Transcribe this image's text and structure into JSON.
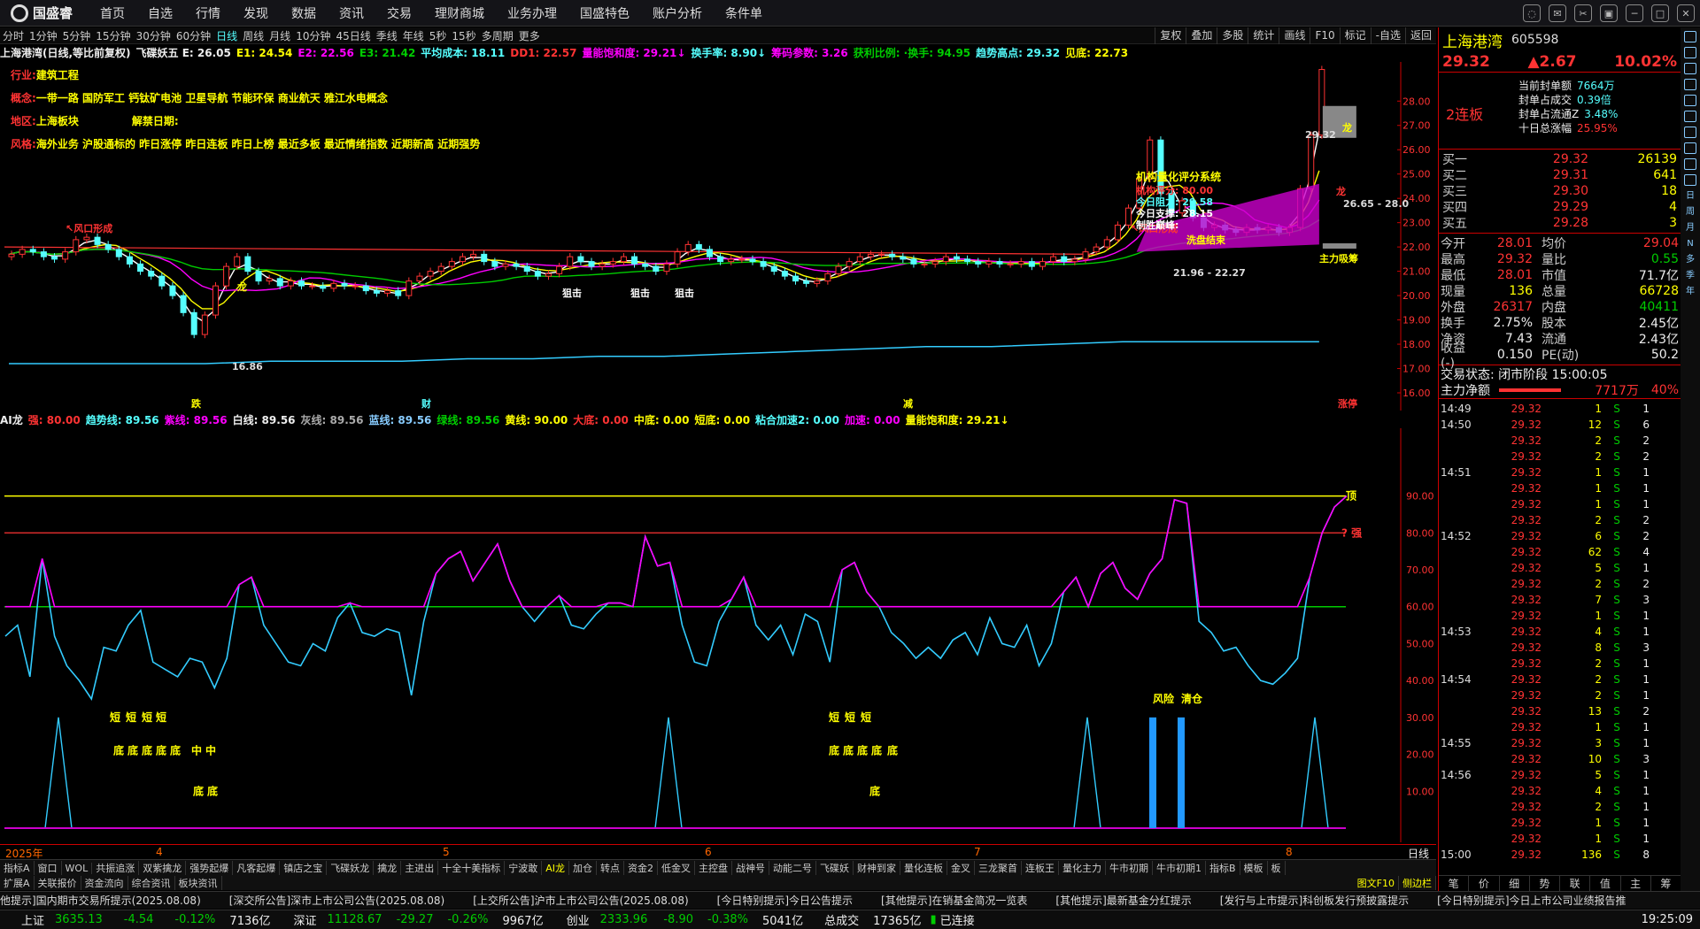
{
  "menu": {
    "logo": "国盛睿",
    "items": [
      "首页",
      "自选",
      "行情",
      "发现",
      "数据",
      "资讯",
      "交易",
      "理财商城",
      "业务办理",
      "国盛特色",
      "账户分析",
      "条件单"
    ]
  },
  "periods": [
    "分时",
    "1分钟",
    "5分钟",
    "15分钟",
    "30分钟",
    "60分钟",
    "日线",
    "周线",
    "月线",
    "10分钟",
    "45日线",
    "季线",
    "年线",
    "5秒",
    "15秒",
    "多周期",
    "更多"
  ],
  "active_period": "日线",
  "tools": [
    "复权",
    "叠加",
    "多股",
    "统计",
    "画线",
    "F10",
    "标记",
    "-自选",
    "返回"
  ],
  "ind1": [
    {
      "t": "上海港湾(日线,等比前复权)",
      "c": "white"
    },
    {
      "t": "飞碟妖五 E: 26.05",
      "c": "white"
    },
    {
      "t": "E1: 24.54",
      "c": "yellow"
    },
    {
      "t": "E2: 22.56",
      "c": "magenta"
    },
    {
      "t": "E3: 21.42",
      "c": "green"
    },
    {
      "t": "平均成本: 18.11",
      "c": "cyan"
    },
    {
      "t": "DD1: 22.57",
      "c": "red"
    },
    {
      "t": "量能饱和度: 29.21↓",
      "c": "magenta"
    },
    {
      "t": "换手率: 8.90↓",
      "c": "cyan"
    },
    {
      "t": "筹码参数: 3.26",
      "c": "magenta"
    },
    {
      "t": "获利比例: ·换手: 94.95",
      "c": "green"
    },
    {
      "t": "趋势高点: 29.32",
      "c": "cyan"
    },
    {
      "t": "见底: 22.73",
      "c": "yellow"
    }
  ],
  "info": {
    "industry_l": "行业:",
    "industry": "建筑工程",
    "concept_l": "概念:",
    "concept": "一带一路 国防军工 钙钛矿电池 卫星导航 节能环保 商业航天 雅江水电概念",
    "region_l": "地区:",
    "region": "上海板块",
    "unlock_l": "解禁日期:",
    "style_l": "风格:",
    "style": "海外业务 沪股通标的 昨日涨停 昨日连板 昨日上榜 最近多板 最近情绪指数 近期新高 近期强势"
  },
  "annotations": {
    "fengkou": "↖风口形成",
    "jgpf": "机构量化评分系统",
    "jgpf_score": "机构评分: 80.00",
    "zl": "今日阻力: 29.58",
    "zc": "今日支撑: 28.15",
    "zskx": "制胜巅峰:",
    "hpl": "洗盘结束",
    "zlxc": "主力吸筹",
    "zlxf": "主力吸筹",
    "lows": "16.86",
    "range": "21.96 - 22.27",
    "hi": "29.32",
    "hi2": "26.65 - 28.0",
    "jiji": "狙击",
    "long": "龙",
    "disp_bottom": "跌",
    "disp_cai": "财",
    "disp_jian": "减",
    "zhang": "涨停"
  },
  "chart_data": [
    {
      "type": "candlestick",
      "title": "上海港湾(日线,等比前复权)",
      "ylim": [
        16,
        29.32
      ],
      "yticks": [
        16,
        17,
        18,
        19,
        20,
        21,
        22,
        23,
        24,
        25,
        26,
        27,
        28
      ],
      "close": [
        21.7,
        21.9,
        21.8,
        21.6,
        21.5,
        21.8,
        22.3,
        22.4,
        22.1,
        21.9,
        21.6,
        21.3,
        21.0,
        20.8,
        20.4,
        20.0,
        19.3,
        18.4,
        19.2,
        20.4,
        21.2,
        21.6,
        21.0,
        20.6,
        20.7,
        20.4,
        20.6,
        20.4,
        20.4,
        20.3,
        20.5,
        20.4,
        20.4,
        20.2,
        20.1,
        20.2,
        20.0,
        20.6,
        20.8,
        21.0,
        21.2,
        21.4,
        21.6,
        21.7,
        21.4,
        21.2,
        21.3,
        21.2,
        21.0,
        20.8,
        20.9,
        21.2,
        21.6,
        21.4,
        21.2,
        21.3,
        21.4,
        21.6,
        21.3,
        21.2,
        21.0,
        21.3,
        21.8,
        22.1,
        21.9,
        21.6,
        21.4,
        21.5,
        21.5,
        21.4,
        21.2,
        21.0,
        20.8,
        20.6,
        20.5,
        20.6,
        20.9,
        21.2,
        21.4,
        21.6,
        21.7,
        21.7,
        21.6,
        21.5,
        21.3,
        21.3,
        21.4,
        21.6,
        21.5,
        21.4,
        21.3,
        21.4,
        21.3,
        21.3,
        21.4,
        21.2,
        21.4,
        21.6,
        21.4,
        21.5,
        21.8,
        22.0,
        22.3,
        22.9,
        23.6,
        24.8,
        26.4,
        24.2,
        23.4,
        23.9,
        23.2,
        22.8,
        22.9,
        22.7,
        22.6,
        22.8,
        22.7,
        22.8,
        22.6,
        22.8,
        24.4,
        26.6,
        29.3
      ],
      "avgcost": [
        17.2,
        17.2,
        17.2,
        17.2,
        17.3,
        17.3,
        17.3,
        17.4,
        17.4,
        17.5,
        17.5,
        17.6,
        17.7,
        17.8,
        17.9,
        17.9,
        18.0,
        18.1,
        18.1,
        18.1,
        18.1
      ],
      "cost_label": "平均成本"
    },
    {
      "type": "line",
      "title": "AI龙",
      "ylim": [
        0,
        100
      ],
      "yticks": [
        10,
        20,
        30,
        40,
        50,
        60,
        70,
        80,
        90
      ],
      "series": [
        {
          "name": "顶",
          "values": [
            90
          ]
        },
        {
          "name": "强",
          "values": [
            80
          ]
        },
        {
          "name": "绿线",
          "values": [
            60
          ]
        },
        {
          "name": "趋势线",
          "values": [
            52,
            55,
            41,
            73,
            52,
            44,
            40,
            35,
            49,
            48,
            55,
            59,
            45,
            43,
            41,
            46,
            45,
            38,
            46,
            66,
            68,
            55,
            50,
            45,
            44,
            50,
            48,
            57,
            61,
            53,
            52,
            54,
            53,
            36,
            56,
            69,
            73,
            75,
            67,
            72,
            77,
            67,
            60,
            56,
            60,
            63,
            55,
            54,
            58,
            61,
            61,
            60,
            79,
            71,
            72,
            55,
            45,
            44,
            56,
            62,
            68,
            55,
            51,
            55,
            47,
            58,
            56,
            45,
            70,
            72,
            64,
            60,
            53,
            50,
            46,
            49,
            46,
            51,
            53,
            47,
            57,
            50,
            49,
            55,
            44,
            50,
            64,
            68,
            60,
            69,
            72,
            65,
            62,
            69,
            73,
            89,
            88,
            56,
            53,
            48,
            49,
            44,
            40,
            39,
            42,
            46,
            68,
            80,
            87,
            90
          ]
        },
        {
          "name": "底",
          "values": [
            30,
            26,
            24,
            29,
            30,
            22,
            27,
            28
          ]
        }
      ],
      "labels": {
        "ding": "顶",
        "qiang": "? 强",
        "fengxian": "风险",
        "qingcang": "清仓",
        "di": "底",
        "duan": "短",
        "zhong": "中"
      }
    }
  ],
  "ind2": [
    {
      "t": "AI龙",
      "c": "white"
    },
    {
      "t": "强: 80.00",
      "c": "red"
    },
    {
      "t": "趋势线: 89.56",
      "c": "cyan"
    },
    {
      "t": "紫线: 89.56",
      "c": "magenta"
    },
    {
      "t": "白线: 89.56",
      "c": "white"
    },
    {
      "t": "灰线: 89.56",
      "c": "gray"
    },
    {
      "t": "蓝线: 89.56",
      "c": "blue"
    },
    {
      "t": "绿线: 89.56",
      "c": "green"
    },
    {
      "t": "黄线: 90.00",
      "c": "yellow"
    },
    {
      "t": "大底: 0.00",
      "c": "red"
    },
    {
      "t": "中底: 0.00",
      "c": "yellow"
    },
    {
      "t": "短底: 0.00",
      "c": "yellow"
    },
    {
      "t": "粘合加速2: 0.00",
      "c": "cyan"
    },
    {
      "t": "加速: 0.00",
      "c": "magenta"
    },
    {
      "t": "量能饱和度: 29.21↓",
      "c": "yellow"
    }
  ],
  "dates": [
    "2025年",
    "4",
    "5",
    "6",
    "7",
    "8"
  ],
  "daily_label": "日线",
  "bottom_tabs": [
    "指标A",
    "窗口",
    "WOL",
    "共振追涨",
    "双紫擒龙",
    "强势起爆",
    "凡客起爆",
    "镇店之宝",
    "飞碟妖龙",
    "擒龙",
    "主进出",
    "十全十美指标",
    "宁波敢",
    "AI龙",
    "加仓",
    "转点",
    "资金2",
    "低金叉",
    "主控盘",
    "战神号",
    "动能二号",
    "飞碟妖",
    "财神到家",
    "量化连板",
    "金叉",
    "三龙聚首",
    "连板王",
    "量化主力",
    "牛市初期",
    "牛市初期1",
    "指标B",
    "模板",
    "板"
  ],
  "bottom_tabs2": [
    "扩展A",
    "关联报价",
    "资金流向",
    "综合资讯",
    "板块资讯"
  ],
  "right_tab_bar": [
    "图文F10",
    "侧边栏"
  ],
  "news": [
    "他提示]国内期市交易所提示(2025.08.08)",
    "[深交所公告]深市上市公司公告(2025.08.08)",
    "[上交所公告]沪市上市公司公告(2025.08.08)",
    "[今日特别提示]今日公告提示",
    "[其他提示]在销基金简况一览表",
    "[其他提示]最新基金分红提示",
    "[发行与上市提示]科创板发行预披露提示",
    "[今日特别提示]今日上市公司业绩报告推"
  ],
  "status": {
    "sh_l": "上证",
    "sh": "3635.13",
    "sh_c": "-4.54",
    "sh_p": "-0.12%",
    "sh_v": "7136亿",
    "sz_l": "深证",
    "sz": "11128.67",
    "sz_c": "-29.27",
    "sz_p": "-0.26%",
    "sz_v": "9967亿",
    "cy_l": "创业",
    "cy": "2333.96",
    "cy_c": "-8.90",
    "cy_p": "-0.38%",
    "cy_v": "5041亿",
    "total_l": "总成交",
    "total": "17365亿",
    "conn": "已连接",
    "time": "19:25:09"
  },
  "quote": {
    "name": "上海港湾",
    "code": "605598",
    "price": "29.32",
    "change": "▲2.67",
    "pct": "10.02%",
    "lianban": "2连板",
    "limit": [
      [
        "当前封单额",
        "7664万"
      ],
      [
        "封单占成交",
        "0.39倍"
      ],
      [
        "封单占流通Z",
        "3.48%"
      ],
      [
        "十日总涨幅",
        "25.95%"
      ]
    ],
    "bids": [
      [
        "买一",
        "29.32",
        "26139"
      ],
      [
        "买二",
        "29.31",
        "641"
      ],
      [
        "买三",
        "29.30",
        "18"
      ],
      [
        "买四",
        "29.29",
        "4"
      ],
      [
        "买五",
        "29.28",
        "3"
      ]
    ],
    "stats": [
      [
        "今开",
        "28.01",
        "均价",
        "29.04"
      ],
      [
        "最高",
        "29.32",
        "量比",
        "0.55"
      ],
      [
        "最低",
        "28.01",
        "市值",
        "71.7亿"
      ],
      [
        "现量",
        "136",
        "总量",
        "66728"
      ],
      [
        "外盘",
        "26317",
        "内盘",
        "40411"
      ],
      [
        "换手",
        "2.75%",
        "股本",
        "2.45亿"
      ],
      [
        "净资",
        "7.43",
        "流通",
        "2.43亿"
      ],
      [
        "收益(-)",
        "0.150",
        "PE(动)",
        "50.2"
      ]
    ],
    "state": "交易状态: 闭市阶段 15:00:05",
    "net_l": "主力净额",
    "net_v": "7717万",
    "net_p": "40%",
    "ticks": [
      [
        "14:49",
        "29.32",
        "1",
        "S",
        "1"
      ],
      [
        "14:50",
        "29.32",
        "12",
        "S",
        "6"
      ],
      [
        "",
        "29.32",
        "2",
        "S",
        "2"
      ],
      [
        "",
        "29.32",
        "2",
        "S",
        "2"
      ],
      [
        "14:51",
        "29.32",
        "1",
        "S",
        "1"
      ],
      [
        "",
        "29.32",
        "1",
        "S",
        "1"
      ],
      [
        "",
        "29.32",
        "1",
        "S",
        "1"
      ],
      [
        "",
        "29.32",
        "2",
        "S",
        "2"
      ],
      [
        "14:52",
        "29.32",
        "6",
        "S",
        "2"
      ],
      [
        "",
        "29.32",
        "62",
        "S",
        "4"
      ],
      [
        "",
        "29.32",
        "5",
        "S",
        "1"
      ],
      [
        "",
        "29.32",
        "2",
        "S",
        "2"
      ],
      [
        "",
        "29.32",
        "7",
        "S",
        "3"
      ],
      [
        "",
        "29.32",
        "1",
        "S",
        "1"
      ],
      [
        "14:53",
        "29.32",
        "4",
        "S",
        "1"
      ],
      [
        "",
        "29.32",
        "8",
        "S",
        "3"
      ],
      [
        "",
        "29.32",
        "2",
        "S",
        "1"
      ],
      [
        "14:54",
        "29.32",
        "2",
        "S",
        "1"
      ],
      [
        "",
        "29.32",
        "2",
        "S",
        "1"
      ],
      [
        "",
        "29.32",
        "13",
        "S",
        "2"
      ],
      [
        "",
        "29.32",
        "1",
        "S",
        "1"
      ],
      [
        "14:55",
        "29.32",
        "3",
        "S",
        "1"
      ],
      [
        "",
        "29.32",
        "10",
        "S",
        "3"
      ],
      [
        "14:56",
        "29.32",
        "5",
        "S",
        "1"
      ],
      [
        "",
        "29.32",
        "4",
        "S",
        "1"
      ],
      [
        "",
        "29.32",
        "2",
        "S",
        "1"
      ],
      [
        "",
        "29.32",
        "1",
        "S",
        "1"
      ],
      [
        "",
        "29.32",
        "1",
        "S",
        "1"
      ],
      [
        "15:00",
        "29.32",
        "136",
        "S",
        "8"
      ]
    ],
    "tabs": [
      "笔",
      "价",
      "细",
      "势",
      "联",
      "值",
      "主",
      "筹"
    ]
  },
  "sidebar": [
    "日",
    "周",
    "月",
    "N",
    "多",
    "季",
    "年"
  ]
}
